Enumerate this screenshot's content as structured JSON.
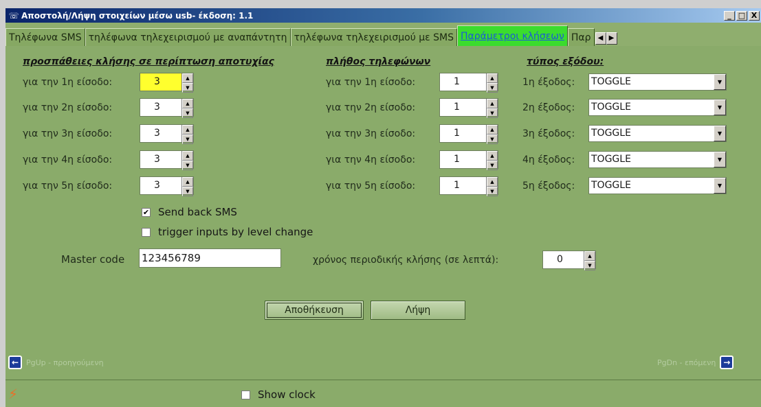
{
  "window": {
    "title": "Αποστολή/Λήψη στοιχείων μέσω usb- έκδοση: 1.1",
    "app_icon": "telephone-icon",
    "buttons": {
      "minimize": "_",
      "maximize": "□",
      "close": "X"
    }
  },
  "tabs": [
    {
      "label": "Τηλέφωνα SMS"
    },
    {
      "label": "τηλέφωνα τηλεχειρισμού με αναπάντητη"
    },
    {
      "label": "τηλέφωνα τηλεχειρισμού με SMS"
    },
    {
      "label": "Παράμετροι κλήσεων"
    },
    {
      "label": "Παρ"
    }
  ],
  "tab_scroll": {
    "left": "◀",
    "right": "▶"
  },
  "attempts": {
    "heading": "προσπάθειες κλήσης σε περίπτωση αποτυχίας",
    "rows": [
      {
        "label": "για την 1η είσοδο:",
        "value": "3"
      },
      {
        "label": "για την 2η είσοδο:",
        "value": "3"
      },
      {
        "label": "για την 3η είσοδο:",
        "value": "3"
      },
      {
        "label": "για την 4η είσοδο:",
        "value": "3"
      },
      {
        "label": "για την 5η είσοδο:",
        "value": "3"
      }
    ]
  },
  "phones_count": {
    "heading": "πλήθος τηλεφώνων",
    "rows": [
      {
        "label": "για την 1η είσοδο:",
        "value": "1"
      },
      {
        "label": "για την 2η είσοδο:",
        "value": "1"
      },
      {
        "label": "για την 3η είσοδο:",
        "value": "1"
      },
      {
        "label": "για την 4η είσοδο:",
        "value": "1"
      },
      {
        "label": "για την 5η είσοδο:",
        "value": "1"
      }
    ]
  },
  "output_type": {
    "heading": "τύπος εξόδου:",
    "rows": [
      {
        "label": "1η έξοδος:",
        "value": "TOGGLE"
      },
      {
        "label": "2η έξοδος:",
        "value": "TOGGLE"
      },
      {
        "label": "3η έξοδος:",
        "value": "TOGGLE"
      },
      {
        "label": "4η έξοδος:",
        "value": "TOGGLE"
      },
      {
        "label": "5η έξοδος:",
        "value": "TOGGLE"
      }
    ]
  },
  "send_back_sms": {
    "label": "Send back SMS",
    "checked": true,
    "mark": "✔"
  },
  "trigger_level": {
    "label": "trigger inputs by level change",
    "checked": false
  },
  "master_code": {
    "label": "Master code",
    "value": "123456789"
  },
  "periodic_call": {
    "label": "χρόνος περιοδικής κλήσης (σε λεπτά):",
    "value": "0"
  },
  "actions": {
    "save": "Αποθήκευση",
    "receive": "Λήψη"
  },
  "nav": {
    "prev": "PgUp - προηγούμενη",
    "next": "PgDn - επόμενη"
  },
  "show_clock": {
    "label": "Show clock",
    "checked": false
  },
  "colors": {
    "panel": "#8aab6a",
    "active_tab": "#3bdc2e",
    "highlight": "#ffff2e"
  }
}
